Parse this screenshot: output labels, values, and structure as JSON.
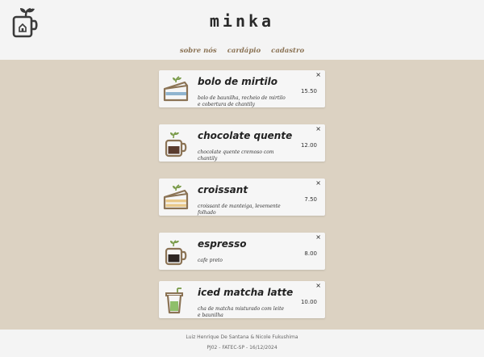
{
  "brand": "minka",
  "nav": {
    "about": "sobre nós",
    "menu": "cardápio",
    "register": "cadastro"
  },
  "products": [
    {
      "name": "bolo de mirtilo",
      "price": "15.50",
      "description": "bolo de baunilha, recheio de mirtilo e cobertura de chantily",
      "icon": "cake-slice-blueberry-icon"
    },
    {
      "name": "chocolate quente",
      "price": "12.00",
      "description": "chocolate quente cremoso com chantily",
      "icon": "hot-chocolate-mug-icon"
    },
    {
      "name": "croissant",
      "price": "7.50",
      "description": "croissant de manteiga, levemente folhado",
      "icon": "croissant-cake-icon"
    },
    {
      "name": "espresso",
      "price": "8.00",
      "description": "cafe preto",
      "icon": "espresso-cup-icon"
    },
    {
      "name": "iced matcha latte",
      "price": "10.00",
      "description": "cha de matcha misturado com leite e baunilha",
      "icon": "iced-matcha-cup-icon"
    }
  ],
  "close_symbol": "×",
  "footer": {
    "authors": "Luiz Henrique De Santana & Nicole Fukushima",
    "course": "PJ02 - FATEC-SP - 16/12/2024"
  },
  "colors": {
    "background": "#dcd2c2",
    "header": "#f4f4f4",
    "accent": "#8b7355",
    "card": "#f6f6f6"
  }
}
